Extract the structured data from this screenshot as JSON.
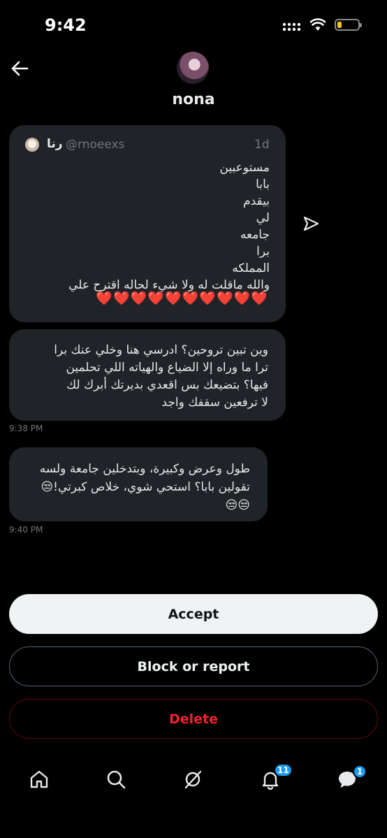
{
  "status_bar": {
    "time": "9:42"
  },
  "header": {
    "back_label": "back",
    "name": "nona"
  },
  "quoted_tweet": {
    "author_name": "رنا",
    "handle": "@rnoeexs",
    "age": "1d",
    "lines": [
      "مستوعبين",
      "بابا",
      "بيقدم",
      "لي",
      "جامعه",
      "برا",
      "المملكه",
      "والله ماقلت له ولا شيء لحاله اقترح علي"
    ],
    "hearts": "❤️❤️❤️❤️❤️❤️❤️❤️❤️❤️"
  },
  "messages": [
    {
      "text": "وين تبين تروحين؟ ادرسي هنا وخلي عنك برا\nترا ما وراه إلا الضياع  والهياته اللي تحلمين\nفيها؟ بتضيعك بس  اقعدي بديرتك أبرك لك\nلا ترفعين سقفك واجد",
      "time": "9:38 PM"
    },
    {
      "text": "طول وعرض وكبيرة، وبتدخلين جامعة ولسه\nتقولين بابا؟ استحي شوي، خلاص كبرتي!😒\n😒😒",
      "time": "9:40 PM"
    }
  ],
  "actions": {
    "accept": "Accept",
    "block": "Block or report",
    "delete": "Delete"
  },
  "nav": {
    "items": [
      "home-icon",
      "search-icon",
      "grok-icon",
      "notifications-icon",
      "messages-icon"
    ],
    "notifications_badge": "11",
    "messages_badge": "1"
  },
  "colors": {
    "accent": "#1d9bf0",
    "danger": "#f4212e",
    "bubble": "#202327"
  }
}
